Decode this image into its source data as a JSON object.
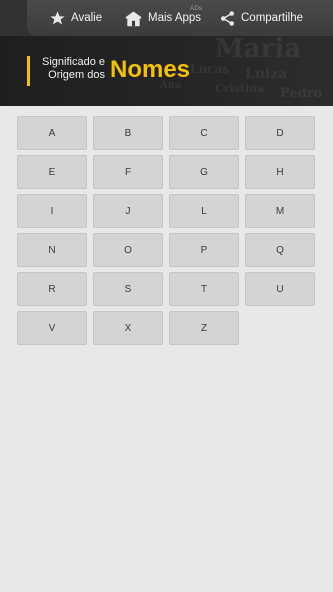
{
  "toolbar": {
    "rate_label": "Avalie",
    "more_apps_label": "Mais Apps",
    "ads_badge": "ADs",
    "share_label": "Compartilhe"
  },
  "header": {
    "title_line1": "Significado e",
    "title_line2": "Origem dos",
    "title_big": "Nomes",
    "accent_color": "#f4c300"
  },
  "letters": [
    "A",
    "B",
    "C",
    "D",
    "E",
    "F",
    "G",
    "H",
    "I",
    "J",
    "L",
    "M",
    "N",
    "O",
    "P",
    "Q",
    "R",
    "S",
    "T",
    "U",
    "V",
    "X",
    "Z"
  ]
}
